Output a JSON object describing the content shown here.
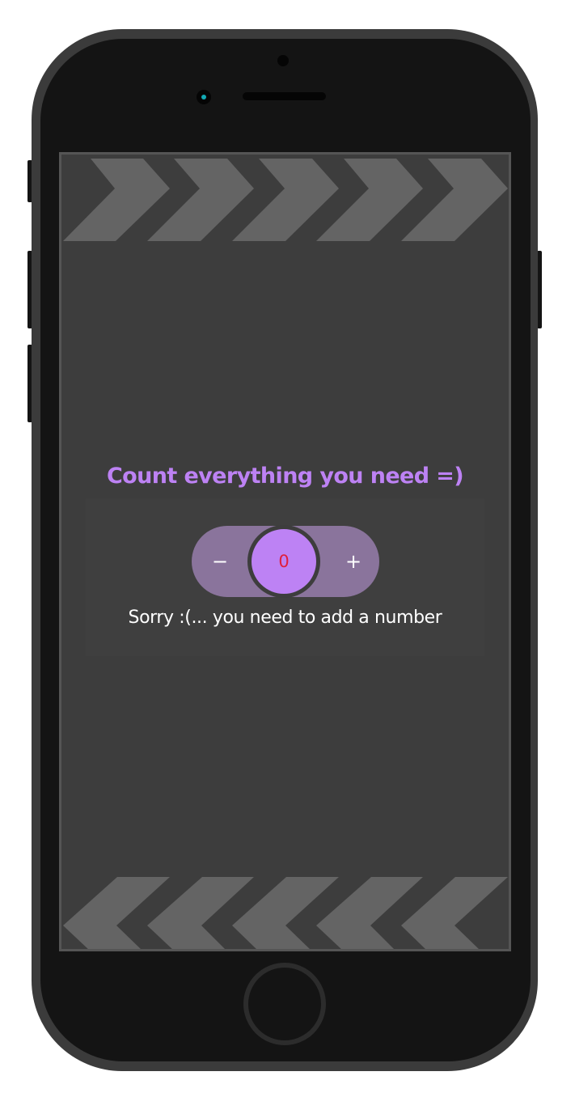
{
  "app": {
    "title": "Count everything you need =)",
    "counter": {
      "decrement_label": "−",
      "value": "0",
      "increment_label": "+"
    },
    "message": "Sorry :(... you need to add a number"
  },
  "device": {
    "frame": "smartphone",
    "icons": [
      "front-camera-icon",
      "proximity-sensor-icon",
      "speaker-grille-icon",
      "home-button-icon"
    ]
  },
  "colors": {
    "accent": "#bd82f4",
    "pill": "#8a749c",
    "value_text": "#e01e3c",
    "screen_bg": "#3d3d3d",
    "chevron": "#646464",
    "phone_frame": "#3b3b3b"
  }
}
